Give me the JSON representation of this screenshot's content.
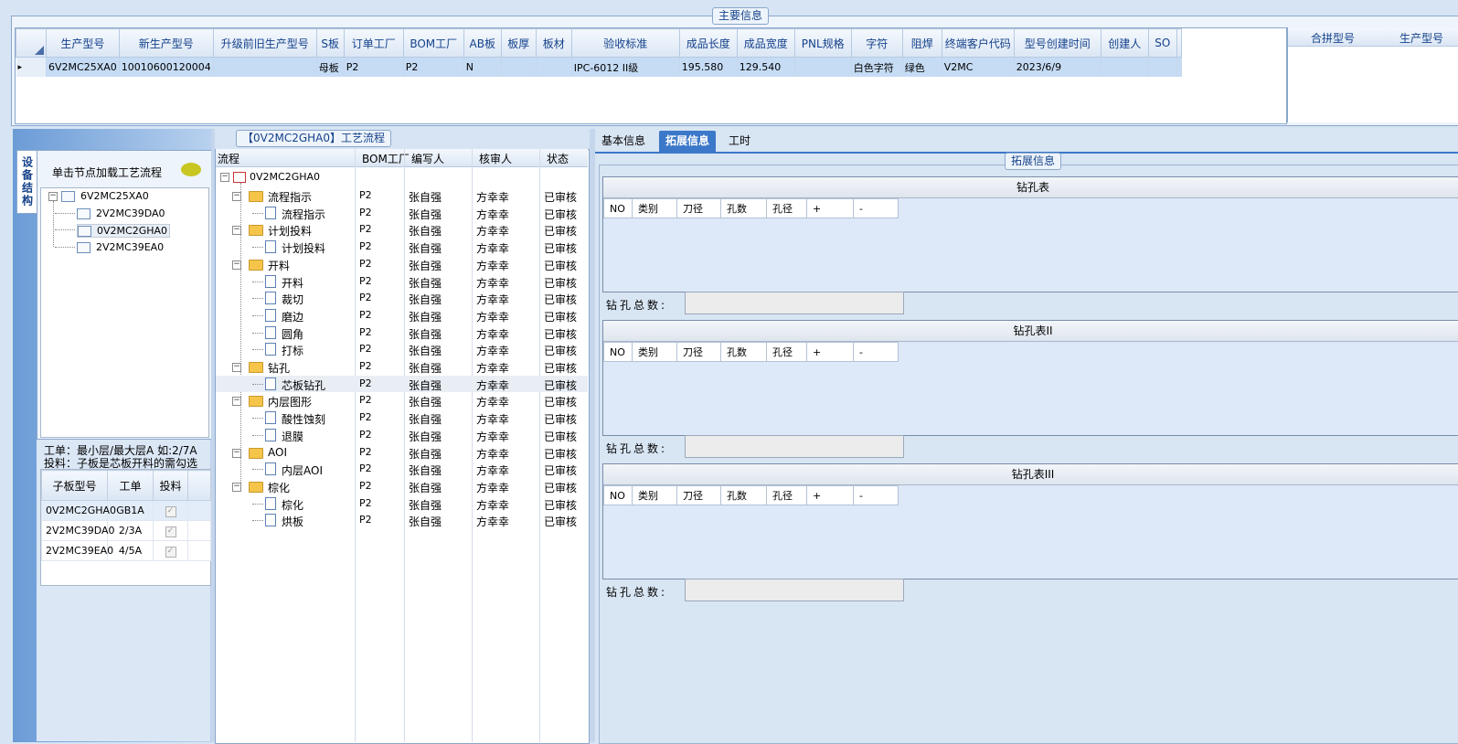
{
  "main_info": {
    "title": "主要信息",
    "columns": [
      "生产型号",
      "新生产型号",
      "升级前旧生产型号",
      "S板",
      "订单工厂",
      "BOM工厂",
      "AB板",
      "板厚",
      "板材",
      "验收标准",
      "成品长度",
      "成品宽度",
      "PNL规格",
      "字符",
      "阻焊",
      "终端客户代码",
      "型号创建时间",
      "创建人",
      "SO"
    ],
    "row": [
      "6V2MC25XA0",
      "10010600120004",
      "",
      "母板",
      "P2",
      "P2",
      "N",
      "",
      "",
      "IPC-6012 II级",
      "195.580",
      "129.540",
      "",
      "白色字符",
      "绿色",
      "V2MC",
      "2023/6/9",
      "",
      ""
    ],
    "row_indicator": "▸",
    "right_columns": [
      "合拼型号",
      "生产型号"
    ]
  },
  "process": {
    "title": "【0V2MC2GHA0】工艺流程",
    "columns": [
      "流程",
      "BOM工厂",
      "编写人",
      "核审人",
      "状态"
    ],
    "root": "0V2MC2GHA0",
    "rows": [
      {
        "name": "流程指示",
        "type": "folder",
        "factory": "P2",
        "writer": "张自强",
        "reviewer": "方幸幸",
        "status": "已审核"
      },
      {
        "name": "流程指示",
        "type": "doc",
        "factory": "P2",
        "writer": "张自强",
        "reviewer": "方幸幸",
        "status": "已审核"
      },
      {
        "name": "计划投料",
        "type": "folder",
        "factory": "P2",
        "writer": "张自强",
        "reviewer": "方幸幸",
        "status": "已审核"
      },
      {
        "name": "计划投料",
        "type": "doc",
        "factory": "P2",
        "writer": "张自强",
        "reviewer": "方幸幸",
        "status": "已审核"
      },
      {
        "name": "开料",
        "type": "folder",
        "factory": "P2",
        "writer": "张自强",
        "reviewer": "方幸幸",
        "status": "已审核"
      },
      {
        "name": "开料",
        "type": "doc",
        "factory": "P2",
        "writer": "张自强",
        "reviewer": "方幸幸",
        "status": "已审核"
      },
      {
        "name": "裁切",
        "type": "doc",
        "factory": "P2",
        "writer": "张自强",
        "reviewer": "方幸幸",
        "status": "已审核"
      },
      {
        "name": "磨边",
        "type": "doc",
        "factory": "P2",
        "writer": "张自强",
        "reviewer": "方幸幸",
        "status": "已审核"
      },
      {
        "name": "圆角",
        "type": "doc",
        "factory": "P2",
        "writer": "张自强",
        "reviewer": "方幸幸",
        "status": "已审核"
      },
      {
        "name": "打标",
        "type": "doc",
        "factory": "P2",
        "writer": "张自强",
        "reviewer": "方幸幸",
        "status": "已审核"
      },
      {
        "name": "钻孔",
        "type": "folder",
        "factory": "P2",
        "writer": "张自强",
        "reviewer": "方幸幸",
        "status": "已审核"
      },
      {
        "name": "芯板钻孔",
        "type": "doc",
        "factory": "P2",
        "writer": "张自强",
        "reviewer": "方幸幸",
        "status": "已审核"
      },
      {
        "name": "内层图形",
        "type": "folder",
        "factory": "P2",
        "writer": "张自强",
        "reviewer": "方幸幸",
        "status": "已审核"
      },
      {
        "name": "酸性蚀刻",
        "type": "doc",
        "factory": "P2",
        "writer": "张自强",
        "reviewer": "方幸幸",
        "status": "已审核"
      },
      {
        "name": "退膜",
        "type": "doc",
        "factory": "P2",
        "writer": "张自强",
        "reviewer": "方幸幸",
        "status": "已审核"
      },
      {
        "name": "AOI",
        "type": "folder",
        "factory": "P2",
        "writer": "张自强",
        "reviewer": "方幸幸",
        "status": "已审核"
      },
      {
        "name": "内层AOI",
        "type": "doc",
        "factory": "P2",
        "writer": "张自强",
        "reviewer": "方幸幸",
        "status": "已审核"
      },
      {
        "name": "棕化",
        "type": "folder",
        "factory": "P2",
        "writer": "张自强",
        "reviewer": "方幸幸",
        "status": "已审核"
      },
      {
        "name": "棕化",
        "type": "doc",
        "factory": "P2",
        "writer": "张自强",
        "reviewer": "方幸幸",
        "status": "已审核"
      },
      {
        "name": "烘板",
        "type": "doc",
        "factory": "P2",
        "writer": "张自强",
        "reviewer": "方幸幸",
        "status": "已审核"
      }
    ]
  },
  "left_panel": {
    "vertical_tab": "设备结构",
    "hint": "单击节点加载工艺流程",
    "tree": [
      "6V2MC25XA0",
      "2V2MC39DA0",
      "0V2MC2GHA0",
      "2V2MC39EA0"
    ],
    "note1": "工单：最小层/最大层A 如:2/7A",
    "note2": "投料：子板是芯板开料的需勾选",
    "sub_columns": [
      "子板型号",
      "工单",
      "投料"
    ],
    "sub_rows": [
      {
        "model": "0V2MC2GHA0",
        "order": "GB1A"
      },
      {
        "model": "2V2MC39DA0",
        "order": "2/3A"
      },
      {
        "model": "2V2MC39EA0",
        "order": "4/5A"
      }
    ],
    "check_glyph": "✓"
  },
  "right_panel": {
    "tabs": [
      "基本信息",
      "拓展信息",
      "工时"
    ],
    "group_title": "拓展信息",
    "drill_columns": [
      "NO",
      "类别",
      "刀径",
      "孔数",
      "孔径",
      "+",
      "-"
    ],
    "tables": [
      {
        "title": "钻孔表",
        "total_label": "钻孔总数:"
      },
      {
        "title": "钻孔表II",
        "total_label": "钻孔总数:"
      },
      {
        "title": "钻孔表III",
        "total_label": "钻孔总数:"
      }
    ]
  }
}
